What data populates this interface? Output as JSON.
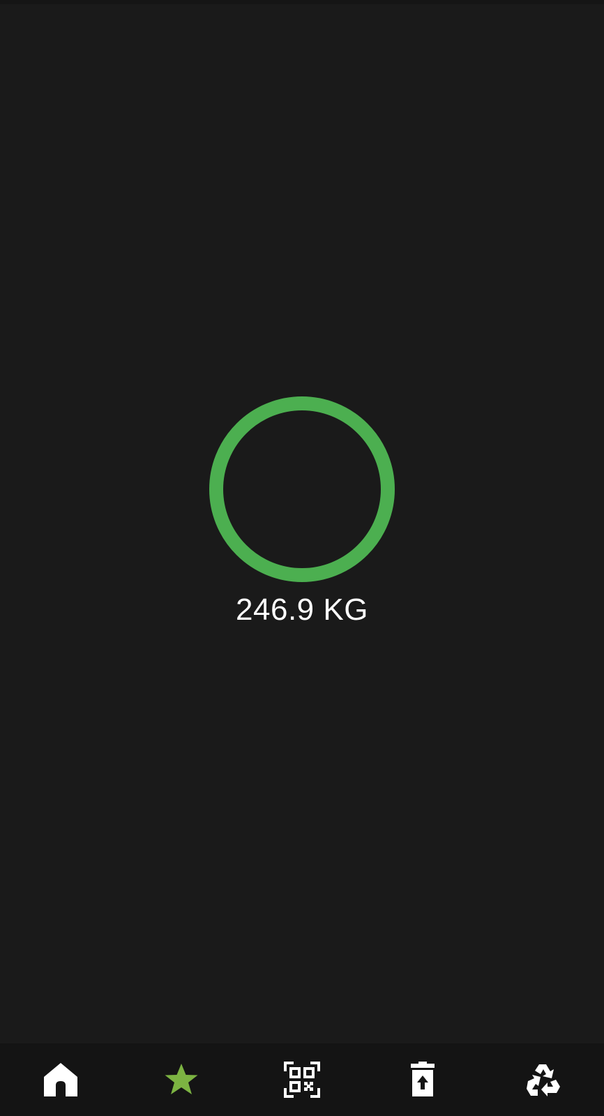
{
  "weight": {
    "value": "246.9 KG",
    "ring_color": "#4caf50"
  },
  "bottom_nav": {
    "items": [
      {
        "id": "home",
        "icon": "home-icon",
        "color": "#ffffff",
        "active": false
      },
      {
        "id": "favorites",
        "icon": "star-icon",
        "color": "#7cb342",
        "active": true
      },
      {
        "id": "scan",
        "icon": "qr-code-scan-icon",
        "color": "#ffffff",
        "active": false
      },
      {
        "id": "disposal",
        "icon": "trash-upload-icon",
        "color": "#ffffff",
        "active": false
      },
      {
        "id": "recycle",
        "icon": "recycle-icon",
        "color": "#ffffff",
        "active": false
      }
    ]
  },
  "colors": {
    "background": "#1a1a1a",
    "nav_background": "#141414",
    "accent_green": "#4caf50",
    "active_icon": "#7cb342"
  }
}
